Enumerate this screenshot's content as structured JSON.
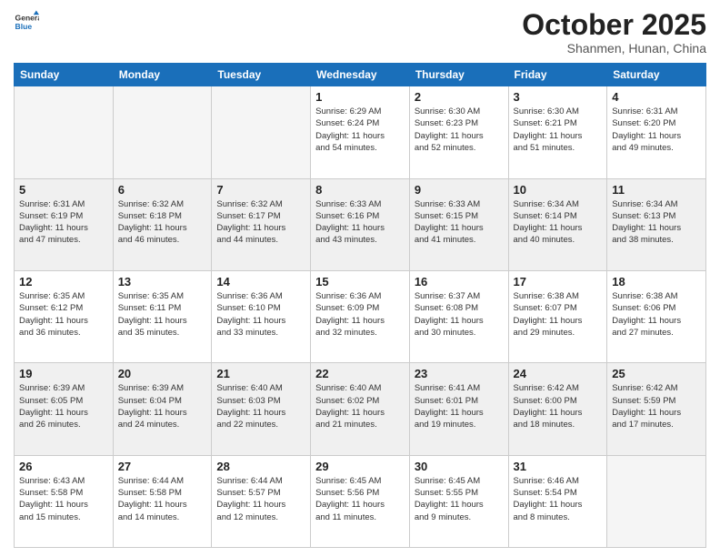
{
  "header": {
    "logo_general": "General",
    "logo_blue": "Blue",
    "month": "October 2025",
    "location": "Shanmen, Hunan, China"
  },
  "days_of_week": [
    "Sunday",
    "Monday",
    "Tuesday",
    "Wednesday",
    "Thursday",
    "Friday",
    "Saturday"
  ],
  "weeks": [
    [
      {
        "day": "",
        "info": ""
      },
      {
        "day": "",
        "info": ""
      },
      {
        "day": "",
        "info": ""
      },
      {
        "day": "1",
        "info": "Sunrise: 6:29 AM\nSunset: 6:24 PM\nDaylight: 11 hours\nand 54 minutes."
      },
      {
        "day": "2",
        "info": "Sunrise: 6:30 AM\nSunset: 6:23 PM\nDaylight: 11 hours\nand 52 minutes."
      },
      {
        "day": "3",
        "info": "Sunrise: 6:30 AM\nSunset: 6:21 PM\nDaylight: 11 hours\nand 51 minutes."
      },
      {
        "day": "4",
        "info": "Sunrise: 6:31 AM\nSunset: 6:20 PM\nDaylight: 11 hours\nand 49 minutes."
      }
    ],
    [
      {
        "day": "5",
        "info": "Sunrise: 6:31 AM\nSunset: 6:19 PM\nDaylight: 11 hours\nand 47 minutes."
      },
      {
        "day": "6",
        "info": "Sunrise: 6:32 AM\nSunset: 6:18 PM\nDaylight: 11 hours\nand 46 minutes."
      },
      {
        "day": "7",
        "info": "Sunrise: 6:32 AM\nSunset: 6:17 PM\nDaylight: 11 hours\nand 44 minutes."
      },
      {
        "day": "8",
        "info": "Sunrise: 6:33 AM\nSunset: 6:16 PM\nDaylight: 11 hours\nand 43 minutes."
      },
      {
        "day": "9",
        "info": "Sunrise: 6:33 AM\nSunset: 6:15 PM\nDaylight: 11 hours\nand 41 minutes."
      },
      {
        "day": "10",
        "info": "Sunrise: 6:34 AM\nSunset: 6:14 PM\nDaylight: 11 hours\nand 40 minutes."
      },
      {
        "day": "11",
        "info": "Sunrise: 6:34 AM\nSunset: 6:13 PM\nDaylight: 11 hours\nand 38 minutes."
      }
    ],
    [
      {
        "day": "12",
        "info": "Sunrise: 6:35 AM\nSunset: 6:12 PM\nDaylight: 11 hours\nand 36 minutes."
      },
      {
        "day": "13",
        "info": "Sunrise: 6:35 AM\nSunset: 6:11 PM\nDaylight: 11 hours\nand 35 minutes."
      },
      {
        "day": "14",
        "info": "Sunrise: 6:36 AM\nSunset: 6:10 PM\nDaylight: 11 hours\nand 33 minutes."
      },
      {
        "day": "15",
        "info": "Sunrise: 6:36 AM\nSunset: 6:09 PM\nDaylight: 11 hours\nand 32 minutes."
      },
      {
        "day": "16",
        "info": "Sunrise: 6:37 AM\nSunset: 6:08 PM\nDaylight: 11 hours\nand 30 minutes."
      },
      {
        "day": "17",
        "info": "Sunrise: 6:38 AM\nSunset: 6:07 PM\nDaylight: 11 hours\nand 29 minutes."
      },
      {
        "day": "18",
        "info": "Sunrise: 6:38 AM\nSunset: 6:06 PM\nDaylight: 11 hours\nand 27 minutes."
      }
    ],
    [
      {
        "day": "19",
        "info": "Sunrise: 6:39 AM\nSunset: 6:05 PM\nDaylight: 11 hours\nand 26 minutes."
      },
      {
        "day": "20",
        "info": "Sunrise: 6:39 AM\nSunset: 6:04 PM\nDaylight: 11 hours\nand 24 minutes."
      },
      {
        "day": "21",
        "info": "Sunrise: 6:40 AM\nSunset: 6:03 PM\nDaylight: 11 hours\nand 22 minutes."
      },
      {
        "day": "22",
        "info": "Sunrise: 6:40 AM\nSunset: 6:02 PM\nDaylight: 11 hours\nand 21 minutes."
      },
      {
        "day": "23",
        "info": "Sunrise: 6:41 AM\nSunset: 6:01 PM\nDaylight: 11 hours\nand 19 minutes."
      },
      {
        "day": "24",
        "info": "Sunrise: 6:42 AM\nSunset: 6:00 PM\nDaylight: 11 hours\nand 18 minutes."
      },
      {
        "day": "25",
        "info": "Sunrise: 6:42 AM\nSunset: 5:59 PM\nDaylight: 11 hours\nand 17 minutes."
      }
    ],
    [
      {
        "day": "26",
        "info": "Sunrise: 6:43 AM\nSunset: 5:58 PM\nDaylight: 11 hours\nand 15 minutes."
      },
      {
        "day": "27",
        "info": "Sunrise: 6:44 AM\nSunset: 5:58 PM\nDaylight: 11 hours\nand 14 minutes."
      },
      {
        "day": "28",
        "info": "Sunrise: 6:44 AM\nSunset: 5:57 PM\nDaylight: 11 hours\nand 12 minutes."
      },
      {
        "day": "29",
        "info": "Sunrise: 6:45 AM\nSunset: 5:56 PM\nDaylight: 11 hours\nand 11 minutes."
      },
      {
        "day": "30",
        "info": "Sunrise: 6:45 AM\nSunset: 5:55 PM\nDaylight: 11 hours\nand 9 minutes."
      },
      {
        "day": "31",
        "info": "Sunrise: 6:46 AM\nSunset: 5:54 PM\nDaylight: 11 hours\nand 8 minutes."
      },
      {
        "day": "",
        "info": ""
      }
    ]
  ]
}
